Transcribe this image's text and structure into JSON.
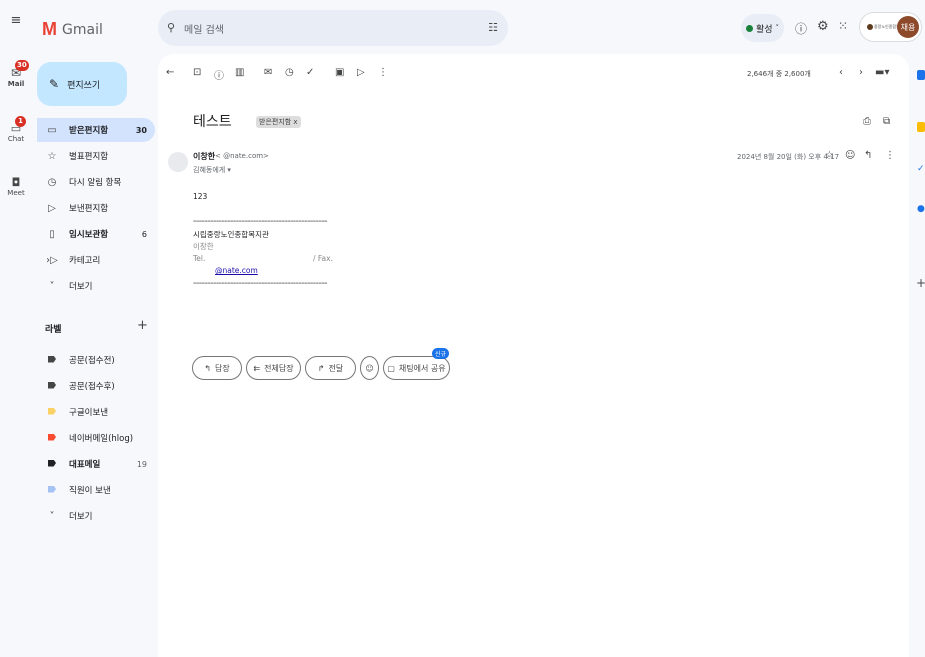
{
  "app": {
    "title": "Gmail",
    "menu_icon": "hamburger-icon"
  },
  "rail": {
    "items": [
      {
        "label": "Mail",
        "badge": "30"
      },
      {
        "label": "Chat",
        "badge": "1"
      },
      {
        "label": "Meet"
      }
    ]
  },
  "search": {
    "placeholder": "메일 검색"
  },
  "header": {
    "status": "활성",
    "account_org": "중랑노인종합복지관",
    "avatar_text": "채용"
  },
  "compose": {
    "label": "편지쓰기"
  },
  "nav": {
    "items": [
      {
        "label": "받은편지함",
        "count": "30",
        "icon": "inbox-icon"
      },
      {
        "label": "별표편지함",
        "count": "",
        "icon": "star-icon"
      },
      {
        "label": "다시 알림 항목",
        "count": "",
        "icon": "clock-icon"
      },
      {
        "label": "보낸편지함",
        "count": "",
        "icon": "send-icon"
      },
      {
        "label": "임시보관함",
        "count": "6",
        "icon": "draft-icon"
      },
      {
        "label": "카테고리",
        "count": "",
        "icon": "label-icon"
      },
      {
        "label": "더보기",
        "count": "",
        "icon": "chevron-down-icon"
      }
    ],
    "labels_title": "라벨",
    "labels": [
      {
        "label": "공문(접수전)",
        "color": "#444746",
        "count": ""
      },
      {
        "label": "공문(접수후)",
        "color": "#444746",
        "count": ""
      },
      {
        "label": "구글이보낸",
        "color": "#fad165",
        "count": ""
      },
      {
        "label": "네이버메일(hlog)",
        "color": "#fb4c2f",
        "count": ""
      },
      {
        "label": "대표메일",
        "color": "#202124",
        "count": "19"
      },
      {
        "label": "직원이 보낸",
        "color": "#a4c2f4",
        "count": ""
      },
      {
        "label": "더보기",
        "color": "",
        "count": ""
      }
    ]
  },
  "toolbar": {
    "pagination": "2,646개 중 2,600개"
  },
  "message": {
    "subject": "테스트",
    "chip": "받은편지함 x",
    "sender_name": "이창한",
    "sender_email": "<  @nate.com>",
    "to_line": "김혜동에게 ▾",
    "date": "2024년 8월 20일 (화) 오후 4:17",
    "body_line1": "123",
    "separator": "===============================================",
    "sig_org": "시립중랑노인종합복지관",
    "sig_name": "이창한",
    "sig_tel": "Tel.",
    "sig_fax": "/ Fax.",
    "sig_email": "@nate.com"
  },
  "actions": {
    "reply": "답장",
    "reply_all": "전체답장",
    "forward": "전달",
    "share_chat": "채팅에서 공유",
    "new_badge": "신규"
  }
}
